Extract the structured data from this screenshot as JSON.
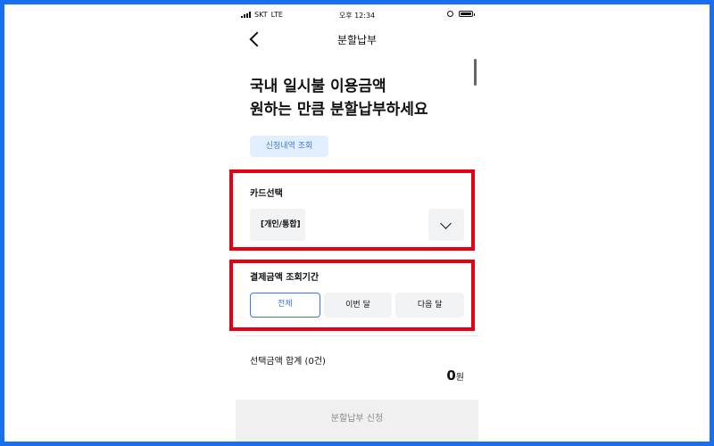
{
  "status_bar": {
    "carrier": "SKT",
    "network": "LTE",
    "time": "오후 12:34"
  },
  "nav": {
    "title": "분할납부",
    "back_icon": "chevron-left-icon"
  },
  "headline": {
    "line1": "국내 일시불 이용금액",
    "line2": "원하는 만큼 분할납부하세요"
  },
  "history_button": "신청내역 조회",
  "card_section": {
    "label": "카드선택",
    "selected_card": "[개인/통합]",
    "dropdown_icon": "chevron-down-icon"
  },
  "period_section": {
    "label": "결제금액 조회기간",
    "options": [
      "전체",
      "이번 달",
      "다음 달"
    ],
    "selected_index": 0
  },
  "summary": {
    "label": "선택금액 합계 (0건)",
    "amount": "0",
    "unit": "원"
  },
  "apply_button": "분할납부 신청",
  "colors": {
    "accent": "#3b78e7",
    "highlight": "#e60012",
    "frame": "#1a6ff0"
  }
}
